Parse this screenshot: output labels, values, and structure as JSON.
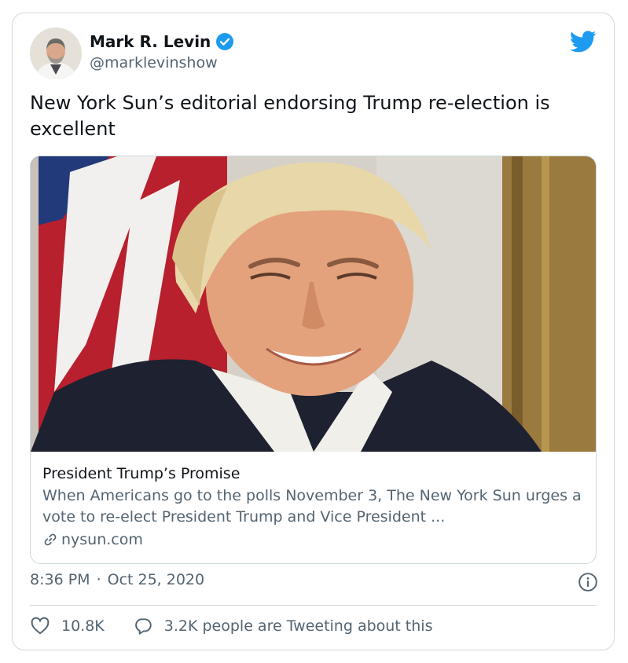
{
  "tweet": {
    "author": {
      "display_name": "Mark R. Levin",
      "handle": "@marklevinshow",
      "verified_icon": "verified-badge-icon",
      "avatar": "avatar-photo"
    },
    "brand_icon": "twitter-bird-icon",
    "text": "New York Sun’s editorial endorsing Trump re-election is excellent",
    "link_card": {
      "image": "portrait-photo",
      "title": "President Trump’s Promise",
      "description": "When Americans go to the polls November 3, The New York Sun urges a vote to re-elect President Trump and Vice President ...",
      "domain": "nysun.com",
      "domain_icon": "link-chain-icon"
    },
    "time": "8:36 PM",
    "separator": "·",
    "date": "Oct 25, 2020",
    "info_icon": "info-icon",
    "likes": {
      "icon": "heart-icon",
      "count": "10.8K"
    },
    "replies": {
      "icon": "speech-bubble-icon",
      "label": "3.2K people are Tweeting about this"
    }
  },
  "colors": {
    "text_primary": "#0f1419",
    "text_secondary": "#536471",
    "border": "#cfd9de",
    "twitter_blue": "#1d9bf0"
  }
}
